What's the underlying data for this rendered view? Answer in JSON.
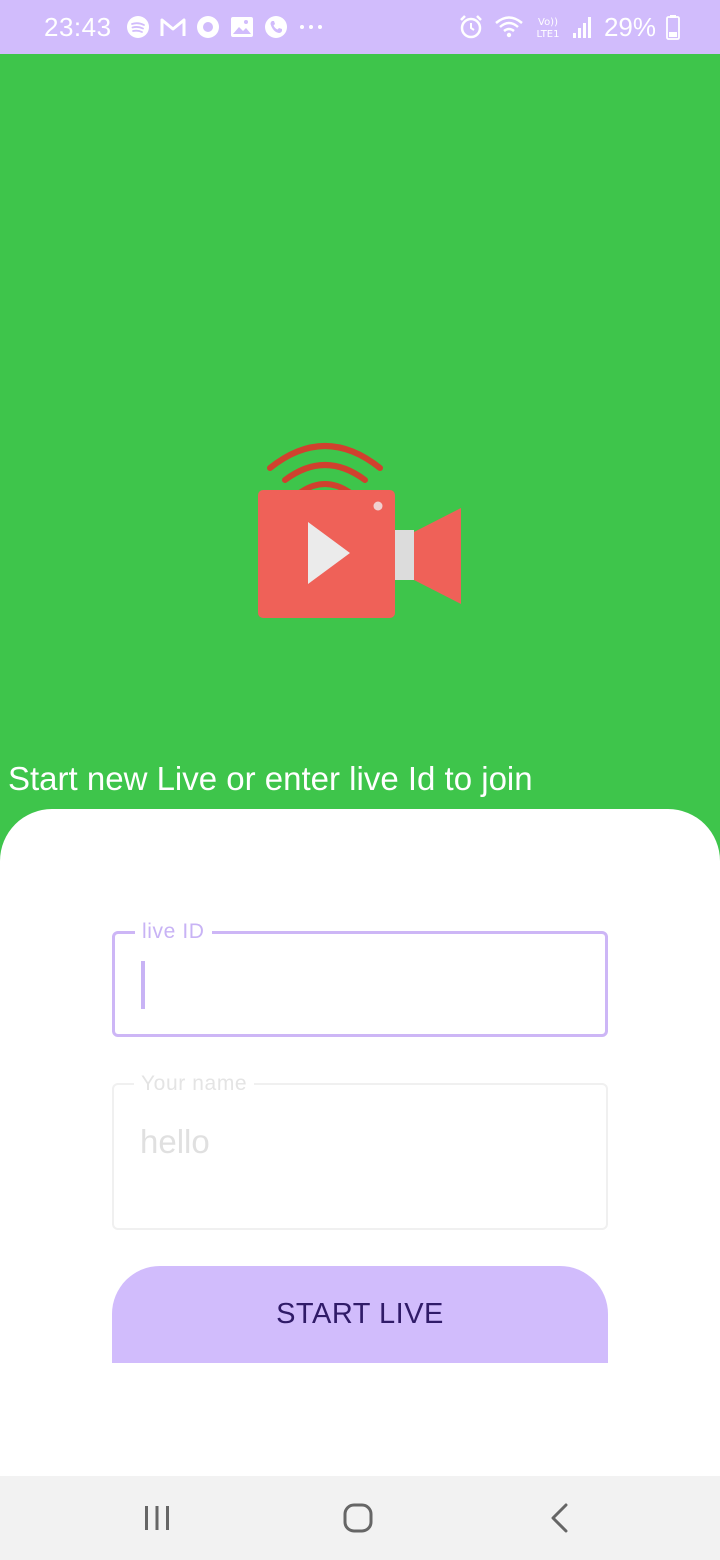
{
  "status_bar": {
    "time": "23:43",
    "battery": "29%",
    "left_icons": [
      "spotify-icon",
      "gmail-icon",
      "circle-app-icon",
      "gallery-icon",
      "phone-icon",
      "more-icon"
    ],
    "right_icons": [
      "alarm-icon",
      "wifi-icon",
      "volte-lte-icon",
      "signal-icon",
      "battery-icon"
    ],
    "background": "#d1bcfc"
  },
  "hero": {
    "background": "#3ec54b",
    "logo_icon": "live-video-camera-icon",
    "subtitle": "Start new Live or enter live Id to join"
  },
  "form": {
    "live_id": {
      "label": "live ID",
      "value": ""
    },
    "name": {
      "label": "Your name",
      "value": "hello"
    },
    "submit_label": "START LIVE",
    "accent": "#d1bcfc"
  },
  "nav_bar": {
    "buttons": [
      "recents-icon",
      "home-icon",
      "back-icon"
    ]
  }
}
